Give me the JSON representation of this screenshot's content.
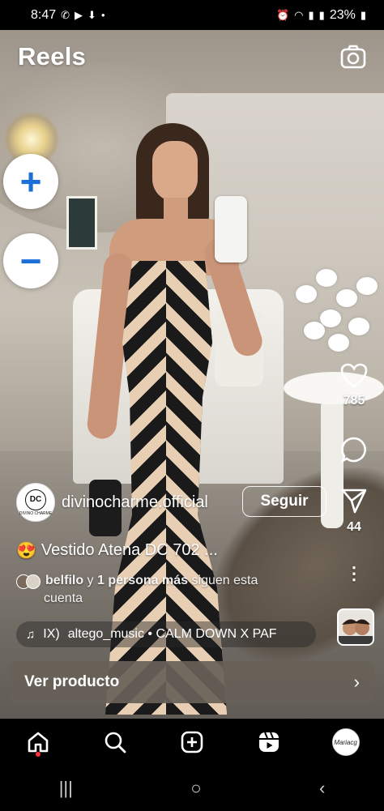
{
  "status_bar": {
    "time": "8:47",
    "battery": "23%",
    "left_icons": [
      "whatsapp-icon",
      "youtube-icon",
      "download-icon",
      "dot"
    ],
    "right_icons": [
      "alarm-icon",
      "wifi-icon",
      "signal-icon",
      "signal-icon",
      "battery-icon"
    ]
  },
  "header": {
    "title": "Reels",
    "camera_icon": "camera-icon"
  },
  "zoom": {
    "in_label": "+",
    "out_label": "−"
  },
  "actions": {
    "likes": "785",
    "shares": "44",
    "more": "⋮"
  },
  "post": {
    "avatar_monogram": "DC",
    "avatar_tiny": "DIVINO CHARME",
    "username": "divinocharme.official",
    "follow_label": "Seguir",
    "caption_emoji": "😍",
    "caption": "Vestido Atena DC 702 ...",
    "followers_name": "belfilo",
    "followers_mid": " y ",
    "followers_count": "1 persona más",
    "followers_tail": " siguen esta",
    "followers_line2": "cuenta",
    "audio_prefix": "IX)",
    "audio_text": "altego_music • CALM DOWN X PAF"
  },
  "product": {
    "label": "Ver producto",
    "chevron": "›"
  },
  "bottom_nav": {
    "items": [
      "home-icon",
      "search-icon",
      "create-icon",
      "reels-icon",
      "profile-avatar"
    ],
    "profile_text": "Mariacg"
  },
  "system_nav": {
    "recent": "|||",
    "home": "○",
    "back": "‹"
  },
  "colors": {
    "accent_blue": "#1c6fd6",
    "notification_red": "#ff3040",
    "product_bar": "#676158"
  }
}
